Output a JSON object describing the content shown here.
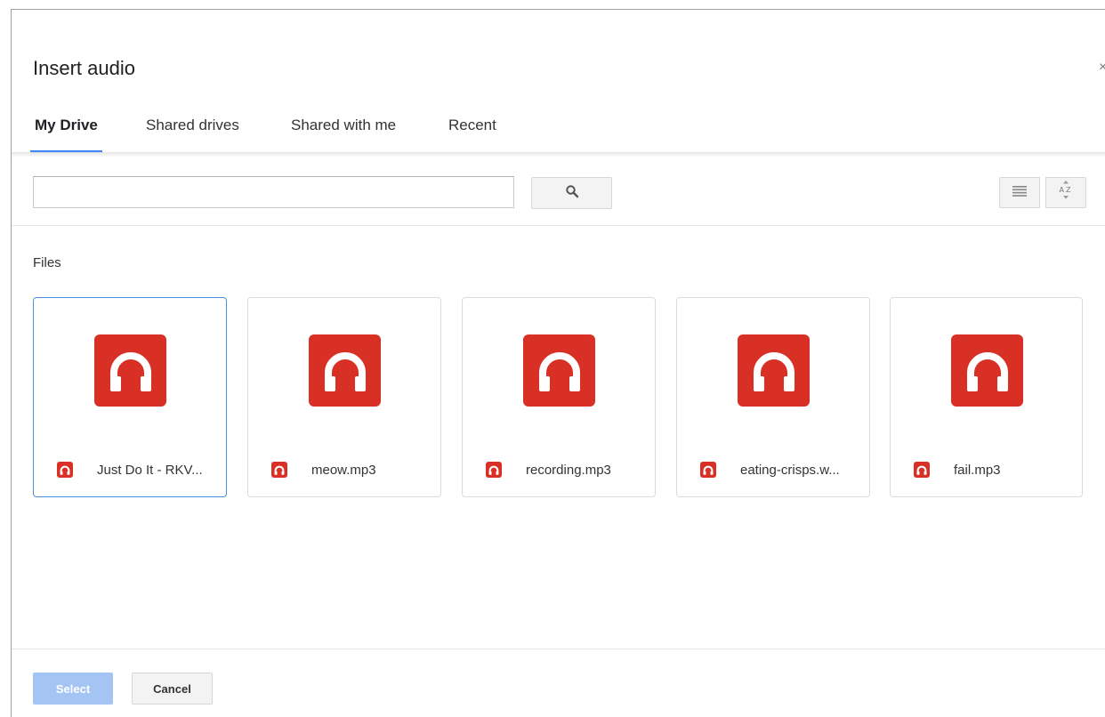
{
  "dialog": {
    "title": "Insert audio",
    "close_glyph": "×"
  },
  "tabs": [
    {
      "label": "My Drive",
      "active": true
    },
    {
      "label": "Shared drives",
      "active": false
    },
    {
      "label": "Shared with me",
      "active": false
    },
    {
      "label": "Recent",
      "active": false
    }
  ],
  "search": {
    "value": "",
    "placeholder": "",
    "button_icon": "search-icon"
  },
  "view_controls": {
    "list_icon": "list-view-icon",
    "sort_icon": "sort-az-icon",
    "sort_glyph": "AZ"
  },
  "files": {
    "section_label": "Files",
    "items": [
      {
        "name": "Just Do It - RKV...",
        "icon": "audio-headphones-icon",
        "selected": true
      },
      {
        "name": "meow.mp3",
        "icon": "audio-headphones-icon",
        "selected": false
      },
      {
        "name": "recording.mp3",
        "icon": "audio-headphones-icon",
        "selected": false
      },
      {
        "name": "eating-crisps.w...",
        "icon": "audio-headphones-icon",
        "selected": false
      },
      {
        "name": "fail.mp3",
        "icon": "audio-headphones-icon",
        "selected": false
      }
    ]
  },
  "footer": {
    "select_label": "Select",
    "cancel_label": "Cancel"
  },
  "colors": {
    "accent": "#4285f4",
    "audio_icon": "#d93025",
    "select_disabled": "#a4c5f4"
  }
}
